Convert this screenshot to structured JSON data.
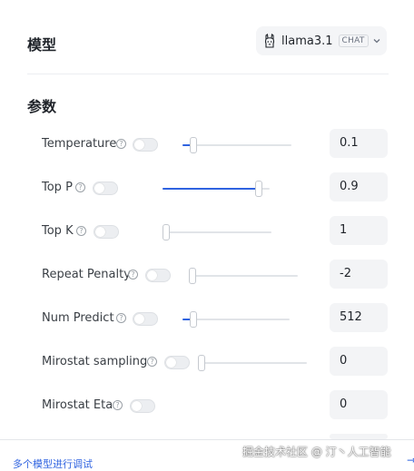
{
  "model_section": {
    "title": "模型",
    "selected_model": "llama3.1",
    "model_badge": "CHAT"
  },
  "params_section": {
    "title": "参数",
    "help_glyph": "?",
    "rows": [
      {
        "label": "Temperature",
        "value": "0.1",
        "slider_fraction": 0.1
      },
      {
        "label": "Top P",
        "value": "0.9",
        "slider_fraction": 0.9
      },
      {
        "label": "Top K",
        "value": "1",
        "slider_fraction": 0.0
      },
      {
        "label": "Repeat Penalty",
        "value": "-2",
        "slider_fraction": 0.0
      },
      {
        "label": "Num Predict",
        "value": "512",
        "slider_fraction": 0.1
      },
      {
        "label": "Mirostat sampling",
        "value": "0",
        "slider_fraction": 0.0
      },
      {
        "label": "Mirostat Eta",
        "value": "0"
      }
    ]
  },
  "footer": {
    "link_text": "多个模型进行调试",
    "arrow": "→",
    "watermark": "掘金技术社区 @ 汀丶人工智能"
  },
  "colors": {
    "accent": "#2f63e0"
  }
}
